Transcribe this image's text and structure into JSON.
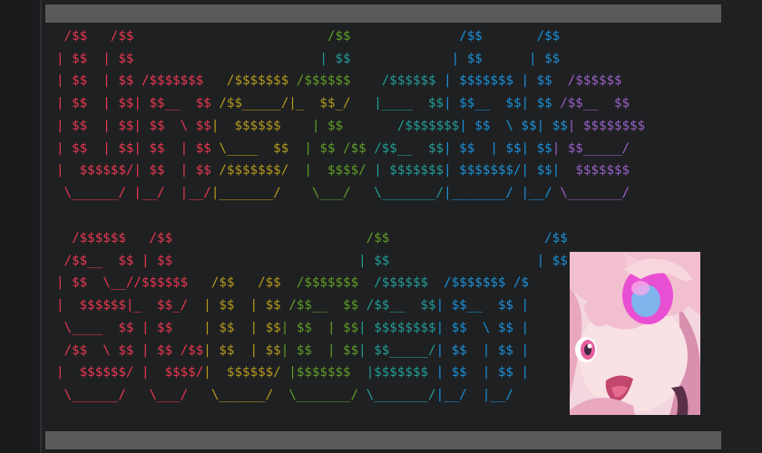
{
  "palette": {
    "red": "#e8384f",
    "orange": "#ec6f3d",
    "olive": "#b59a1c",
    "green": "#5f9e27",
    "teal": "#219e98",
    "blue": "#1a90d8",
    "violet": "#9a5fc7",
    "background": "#1f2022",
    "bar": "#5a5a5a"
  },
  "banner_top": {
    "lines": [
      [
        {
          "t": " /$$   /$$                         ",
          "c": "red"
        },
        {
          "t": "/$$              ",
          "c": "green"
        },
        {
          "t": "/$$       /$$",
          "c": "blue"
        }
      ],
      [
        {
          "t": "| $$  | $$                        ",
          "c": "red"
        },
        {
          "t": "| $$             ",
          "c": "teal"
        },
        {
          "t": "| $$      | $$",
          "c": "blue"
        }
      ],
      [
        {
          "t": "| $$  | $$ /$$$$$$$   ",
          "c": "red"
        },
        {
          "t": "/$$$$$$$ ",
          "c": "olive"
        },
        {
          "t": "/$$$$$$    ",
          "c": "green"
        },
        {
          "t": "/$$$$$$ ",
          "c": "teal"
        },
        {
          "t": "| $$$$$$$ | $$  ",
          "c": "blue"
        },
        {
          "t": "/$$$$$$",
          "c": "violet"
        }
      ],
      [
        {
          "t": "| $$  | $$| $$__  $$ ",
          "c": "red"
        },
        {
          "t": "/$$_____/|_  $$_/   ",
          "c": "olive"
        },
        {
          "t": "|____  $$",
          "c": "teal"
        },
        {
          "t": "| $$__  $$| $$ ",
          "c": "blue"
        },
        {
          "t": "/$$__  $$",
          "c": "violet"
        }
      ],
      [
        {
          "t": "| $$  | $$| $$  \\ $$",
          "c": "red"
        },
        {
          "t": "|  $$$$$$    ",
          "c": "olive"
        },
        {
          "t": "| $$       ",
          "c": "green"
        },
        {
          "t": "/$$$$$$$",
          "c": "teal"
        },
        {
          "t": "| $$  \\ $$| $$",
          "c": "blue"
        },
        {
          "t": "| $$$$$$$$",
          "c": "violet"
        }
      ],
      [
        {
          "t": "| $$  | $$| $$  | $$ ",
          "c": "red"
        },
        {
          "t": "\\____  $$",
          "c": "olive"
        },
        {
          "t": "  | $$ /$$ ",
          "c": "green"
        },
        {
          "t": "/$$__  $$",
          "c": "teal"
        },
        {
          "t": "| $$  | $$| $$",
          "c": "blue"
        },
        {
          "t": "| $$_____/",
          "c": "violet"
        }
      ],
      [
        {
          "t": "|  $$$$$$/| $$  | $$ ",
          "c": "red"
        },
        {
          "t": "/$$$$$$$/",
          "c": "olive"
        },
        {
          "t": "  |  $$$$/ ",
          "c": "green"
        },
        {
          "t": "| $$$$$$$",
          "c": "teal"
        },
        {
          "t": "| $$$$$$$/| $$|  ",
          "c": "blue"
        },
        {
          "t": "$$$$$$$",
          "c": "violet"
        }
      ],
      [
        {
          "t": " \\______/ |__/  |__/",
          "c": "red"
        },
        {
          "t": "|_______/",
          "c": "olive"
        },
        {
          "t": "    \\___/   ",
          "c": "green"
        },
        {
          "t": "\\_______/",
          "c": "teal"
        },
        {
          "t": "|_______/ |__/ ",
          "c": "blue"
        },
        {
          "t": "\\_______/",
          "c": "violet"
        }
      ]
    ]
  },
  "banner_bottom": {
    "lines": [
      [
        {
          "t": "  /$$$$$$   /$$                         ",
          "c": "red"
        },
        {
          "t": "/$$                    ",
          "c": "green"
        },
        {
          "t": "/$$",
          "c": "blue"
        }
      ],
      [
        {
          "t": " /$$__  $$ | $$                        ",
          "c": "red"
        },
        {
          "t": "| $$                   ",
          "c": "teal"
        },
        {
          "t": "| $$",
          "c": "blue"
        }
      ],
      [
        {
          "t": "| $$  \\__//$$$$$$   ",
          "c": "red"
        },
        {
          "t": "/$$   /$$  ",
          "c": "olive"
        },
        {
          "t": "/$$$$$$$  ",
          "c": "green"
        },
        {
          "t": "/$$$$$$  ",
          "c": "teal"
        },
        {
          "t": "/$$$$$$$ /$",
          "c": "blue"
        }
      ],
      [
        {
          "t": "|  $$$$$$|_  $$_/  ",
          "c": "red"
        },
        {
          "t": "| $$  | $$ ",
          "c": "olive"
        },
        {
          "t": "/$$__  $$ ",
          "c": "green"
        },
        {
          "t": "/$$__  $$",
          "c": "teal"
        },
        {
          "t": "| $$__  $$ |",
          "c": "blue"
        }
      ],
      [
        {
          "t": " \\____  $$ | $$    ",
          "c": "red"
        },
        {
          "t": "| $$  | $$",
          "c": "olive"
        },
        {
          "t": "| $$  | $$",
          "c": "green"
        },
        {
          "t": "| $$$$$$$$",
          "c": "teal"
        },
        {
          "t": "| $$  \\ $$ |",
          "c": "blue"
        }
      ],
      [
        {
          "t": " /$$  \\ $$ | $$ /$$",
          "c": "red"
        },
        {
          "t": "| $$  | $$",
          "c": "olive"
        },
        {
          "t": "| $$  | $$",
          "c": "green"
        },
        {
          "t": "| $$_____/",
          "c": "teal"
        },
        {
          "t": "| $$  | $$ |",
          "c": "blue"
        }
      ],
      [
        {
          "t": "|  $$$$$$/ |  $$$$/",
          "c": "red"
        },
        {
          "t": "|  $$$$$$/ ",
          "c": "olive"
        },
        {
          "t": "|$$$$$$$  ",
          "c": "green"
        },
        {
          "t": "|$$$$$$$ ",
          "c": "teal"
        },
        {
          "t": "| $$  | $$ |",
          "c": "blue"
        }
      ],
      [
        {
          "t": " \\______/   \\___/   ",
          "c": "red"
        },
        {
          "t": "\\______/  ",
          "c": "olive"
        },
        {
          "t": "\\_______/ ",
          "c": "green"
        },
        {
          "t": "\\_______/",
          "c": "teal"
        },
        {
          "t": "|__/  |__/",
          "c": "blue"
        }
      ]
    ]
  },
  "portrait": {
    "hair": "#f1bfd0",
    "hair_dark": "#d98fae",
    "skin": "#f9e2e4",
    "orb": "#e94fd2",
    "orb_core": "#6cc5f2",
    "eye": "#e75f9e"
  }
}
